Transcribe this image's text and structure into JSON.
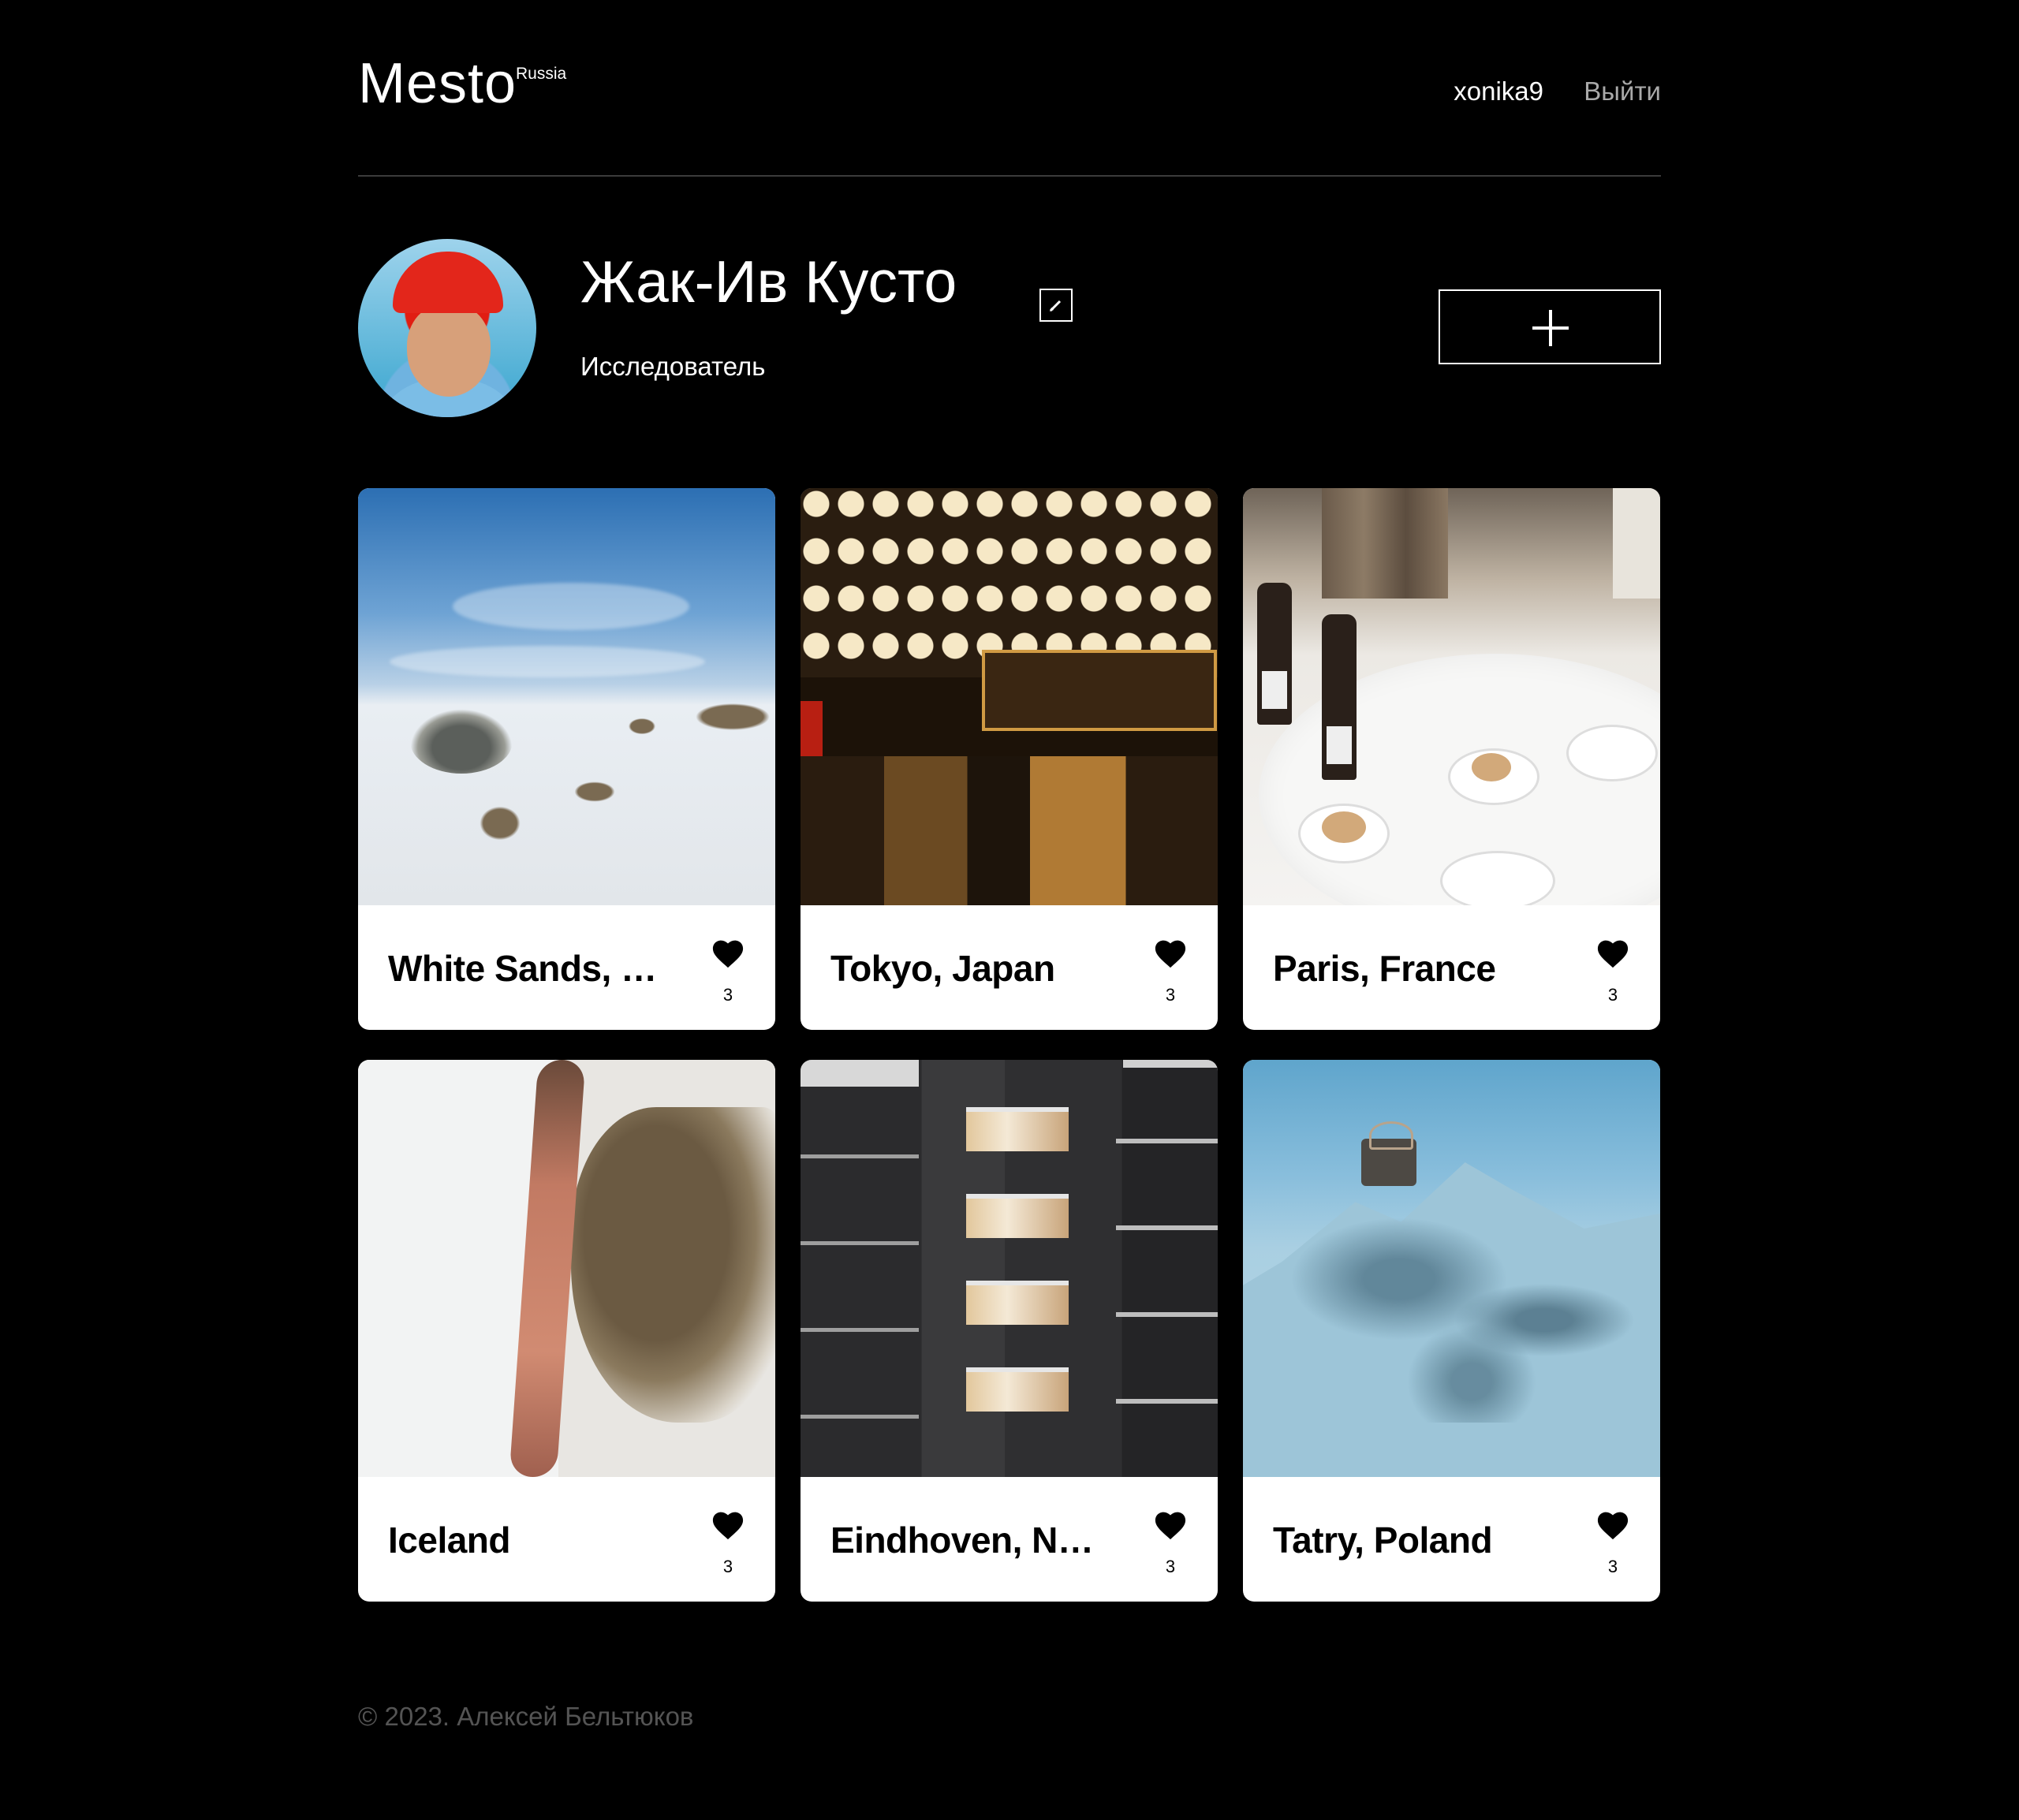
{
  "header": {
    "logo": "Mesto",
    "logo_sup": "Russia",
    "user_email": "xonika9",
    "logout_label": "Выйти"
  },
  "profile": {
    "name": "Жак-Ив Кусто",
    "about": "Исследователь",
    "avatar_alt": "avatar",
    "edit_icon": "pencil-icon",
    "add_icon": "plus-icon"
  },
  "cards": [
    {
      "title": "White Sands, New Mexico",
      "likes": "3",
      "image": "white-sands"
    },
    {
      "title": "Tokyo, Japan",
      "likes": "3",
      "image": "tokyo"
    },
    {
      "title": "Paris, France",
      "likes": "3",
      "image": "paris"
    },
    {
      "title": "Iceland",
      "likes": "3",
      "image": "iceland"
    },
    {
      "title": "Eindhoven, Netherlands",
      "likes": "3",
      "image": "eindhoven"
    },
    {
      "title": "Tatry, Poland",
      "likes": "3",
      "image": "tatry"
    }
  ],
  "footer": {
    "copyright": "© 2023. Алексей Бельтюков"
  },
  "colors": {
    "background": "#000000",
    "text": "#ffffff",
    "muted": "#a9a9a9",
    "footer_text": "#545454",
    "card_bg": "#ffffff"
  }
}
